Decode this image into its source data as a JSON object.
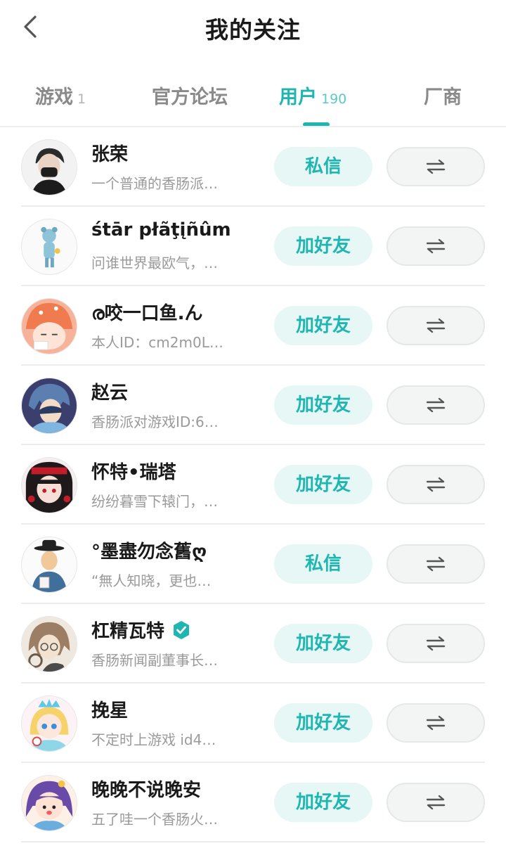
{
  "header": {
    "title": "我的关注",
    "back_icon": "chevron-left-icon"
  },
  "tabs": [
    {
      "label": "游戏",
      "count": "1",
      "active": false
    },
    {
      "label": "官方论坛",
      "count": "",
      "active": false
    },
    {
      "label": "用户",
      "count": "190",
      "active": true
    },
    {
      "label": "厂商",
      "count": "",
      "active": false
    }
  ],
  "colors": {
    "accent": "#1fb6b2",
    "button_bg": "#e6f7f6",
    "swap_bg": "#f3f5f5"
  },
  "users": [
    {
      "name": "张荣",
      "bio": "一个普通的香肠派…",
      "action": "私信",
      "verified": false
    },
    {
      "name": "śtār płãţįñûm",
      "bio": "问谁世界最欧气，…",
      "action": "加好友",
      "verified": false
    },
    {
      "name": "ര咬一口鱼.ん",
      "bio": "本人ID：cm2m0L…",
      "action": "加好友",
      "verified": false
    },
    {
      "name": "赵云",
      "bio": "香肠派对游戏ID:6…",
      "action": "加好友",
      "verified": false
    },
    {
      "name": "怀特•瑞塔",
      "bio": "纷纷暮雪下辕门，…",
      "action": "加好友",
      "verified": false
    },
    {
      "name": "°墨盡勿念舊ღ",
      "bio": "“無人知晓，更也…",
      "action": "私信",
      "verified": false
    },
    {
      "name": "杠精瓦特",
      "bio": "香肠新闻副董事长…",
      "action": "加好友",
      "verified": true
    },
    {
      "name": "挽星",
      "bio": "不定时上游戏 id4…",
      "action": "加好友",
      "verified": false
    },
    {
      "name": "晚晚不说晚安",
      "bio": "五了哇一个香肠火…",
      "action": "加好友",
      "verified": false
    }
  ],
  "swap_icon": "swap-arrows-icon"
}
